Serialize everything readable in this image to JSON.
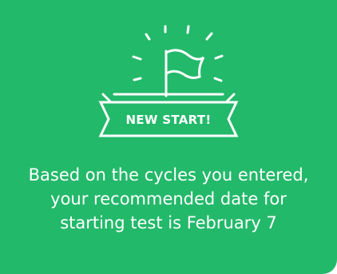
{
  "card": {
    "background_color": "#23b96a",
    "icon": "flag-icon",
    "badge_label": "NEW START!",
    "message_lines": [
      "Based on the cycles you entered,",
      "your recommended date for",
      "starting test is February 7"
    ]
  }
}
